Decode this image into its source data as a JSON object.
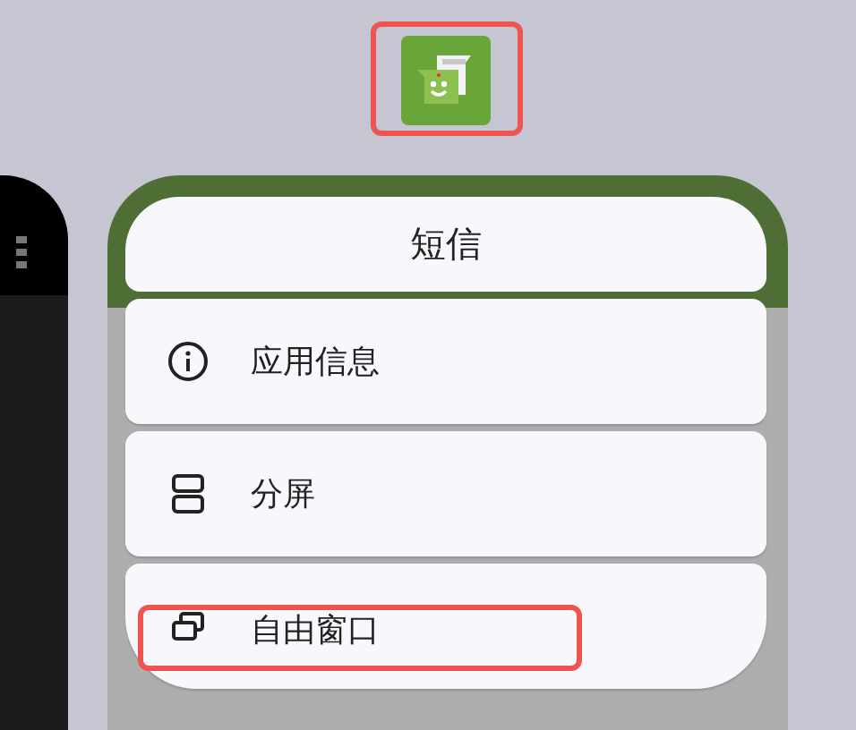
{
  "app_icon": {
    "highlighted": true
  },
  "menu": {
    "title": "短信",
    "items": [
      {
        "kind": "info",
        "label": "应用信息",
        "highlighted": false
      },
      {
        "kind": "split",
        "label": "分屏",
        "highlighted": false
      },
      {
        "kind": "freeform",
        "label": "自由窗口",
        "highlighted": true
      }
    ]
  }
}
